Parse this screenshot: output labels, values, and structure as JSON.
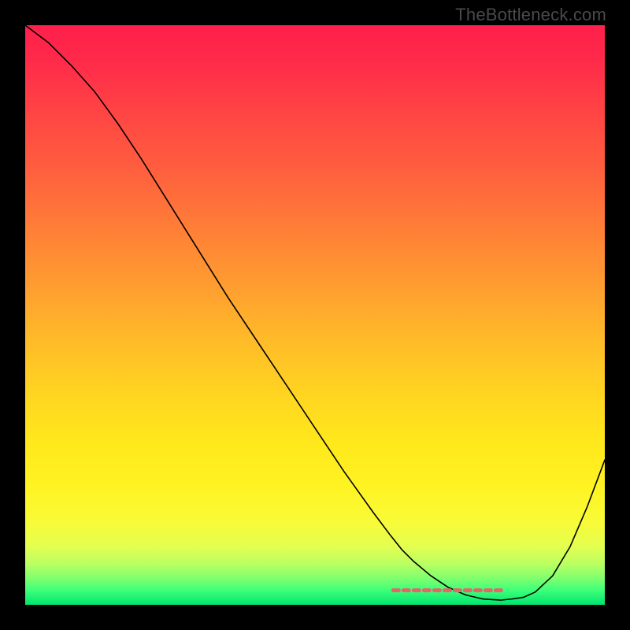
{
  "watermark": "TheBottleneck.com",
  "chart_data": {
    "type": "line",
    "title": "",
    "xlabel": "",
    "ylabel": "",
    "xlim": [
      0,
      100
    ],
    "ylim": [
      0,
      100
    ],
    "series": [
      {
        "name": "bottleneck-curve",
        "x": [
          0,
          4,
          8,
          12,
          16,
          20,
          25,
          30,
          35,
          40,
          45,
          50,
          55,
          60,
          63,
          65,
          67,
          70,
          73,
          76,
          79,
          82,
          84,
          86,
          88,
          91,
          94,
          97,
          100
        ],
        "y": [
          100,
          97,
          93,
          88.5,
          83,
          77,
          69,
          61,
          53,
          45.5,
          38,
          30.5,
          23,
          16,
          12,
          9.5,
          7.5,
          5,
          3,
          1.7,
          1,
          0.8,
          1,
          1.3,
          2.2,
          5,
          10,
          17,
          25
        ],
        "stroke": "#000000",
        "stroke_width": 1.6
      },
      {
        "name": "highlight-band",
        "x": [
          63.5,
          82.5
        ],
        "y": [
          2.5,
          2.5
        ],
        "stroke": "#e36767",
        "stroke_width": 5,
        "dasharray": "7 6"
      }
    ],
    "gradient_stops": [
      {
        "offset": 0.0,
        "color": "#ff1f4b"
      },
      {
        "offset": 0.06,
        "color": "#ff2a4a"
      },
      {
        "offset": 0.15,
        "color": "#ff4444"
      },
      {
        "offset": 0.25,
        "color": "#ff5f3e"
      },
      {
        "offset": 0.35,
        "color": "#ff7e37"
      },
      {
        "offset": 0.45,
        "color": "#ff9d30"
      },
      {
        "offset": 0.55,
        "color": "#ffbd28"
      },
      {
        "offset": 0.65,
        "color": "#ffd820"
      },
      {
        "offset": 0.72,
        "color": "#ffe81b"
      },
      {
        "offset": 0.8,
        "color": "#fff423"
      },
      {
        "offset": 0.86,
        "color": "#f7fb39"
      },
      {
        "offset": 0.9,
        "color": "#e3ff50"
      },
      {
        "offset": 0.93,
        "color": "#b8ff62"
      },
      {
        "offset": 0.955,
        "color": "#7dff6e"
      },
      {
        "offset": 0.975,
        "color": "#3dff79"
      },
      {
        "offset": 1.0,
        "color": "#00e56f"
      }
    ]
  }
}
